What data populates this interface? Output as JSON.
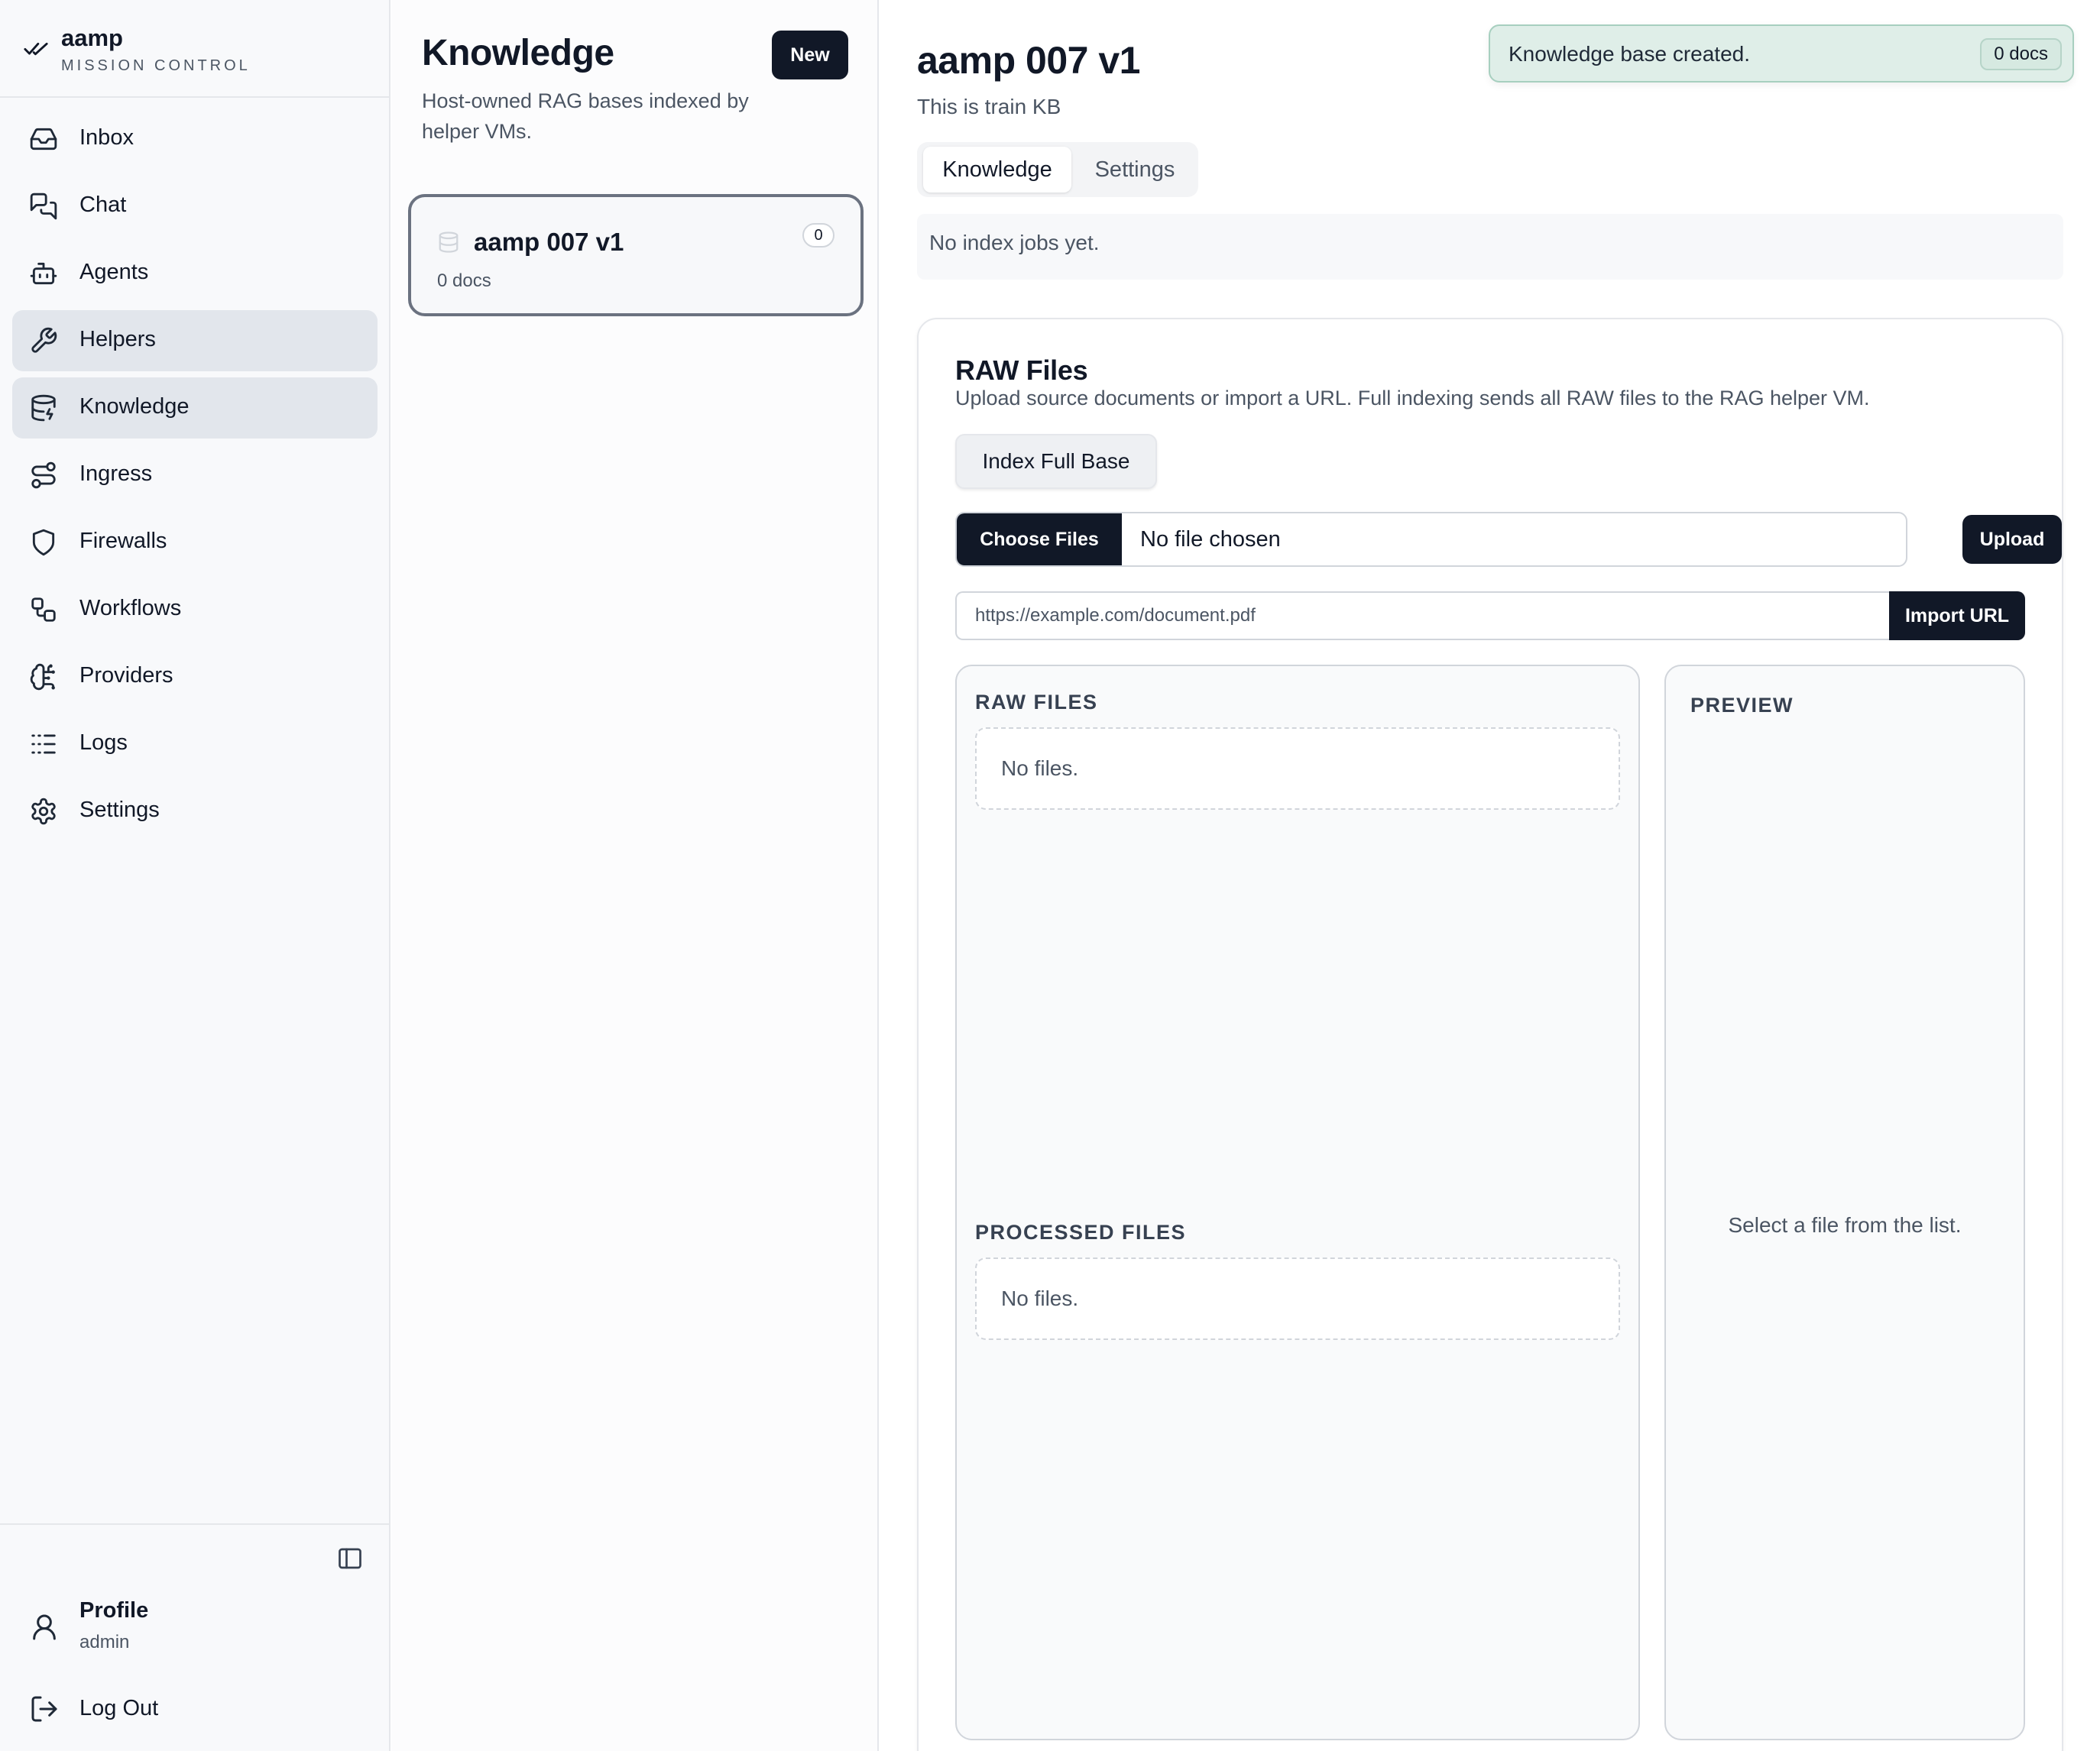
{
  "brand": {
    "name": "aamp",
    "tagline": "MISSION CONTROL"
  },
  "sidebar": {
    "items": [
      {
        "label": "Inbox",
        "icon": "inbox-icon",
        "active": false
      },
      {
        "label": "Chat",
        "icon": "chat-icon",
        "active": false
      },
      {
        "label": "Agents",
        "icon": "bot-icon",
        "active": false
      },
      {
        "label": "Helpers",
        "icon": "wrench-icon",
        "active": true
      },
      {
        "label": "Knowledge",
        "icon": "database-icon",
        "active": true
      },
      {
        "label": "Ingress",
        "icon": "route-icon",
        "active": false
      },
      {
        "label": "Firewalls",
        "icon": "shield-icon",
        "active": false
      },
      {
        "label": "Workflows",
        "icon": "workflow-icon",
        "active": false
      },
      {
        "label": "Providers",
        "icon": "brain-icon",
        "active": false
      },
      {
        "label": "Logs",
        "icon": "list-icon",
        "active": false
      },
      {
        "label": "Settings",
        "icon": "gear-icon",
        "active": false
      }
    ],
    "profile": {
      "label": "Profile",
      "user": "admin"
    },
    "logout_label": "Log Out"
  },
  "knowledge_list": {
    "title": "Knowledge",
    "description": "Host-owned RAG bases indexed by helper VMs.",
    "new_label": "New",
    "bases": [
      {
        "name": "aamp 007 v1",
        "docs": "0 docs",
        "count": "0"
      }
    ]
  },
  "detail": {
    "title": "aamp 007 v1",
    "subtitle": "This is train KB",
    "tabs": [
      "Knowledge",
      "Settings"
    ],
    "active_tab": "Knowledge",
    "jobs_empty": "No index jobs yet.",
    "toast": {
      "message": "Knowledge base created.",
      "badge": "0 docs"
    },
    "raw": {
      "heading": "RAW Files",
      "description": "Upload source documents or import a URL. Full indexing sends all RAW files to the RAG helper VM.",
      "index_label": "Index Full Base",
      "choose_label": "Choose Files",
      "no_file": "No file chosen",
      "upload_label": "Upload",
      "url_placeholder": "https://example.com/document.pdf",
      "import_label": "Import URL",
      "raw_files_label": "RAW FILES",
      "raw_files_empty": "No files.",
      "processed_label": "PROCESSED FILES",
      "processed_empty": "No files.",
      "preview_label": "PREVIEW",
      "preview_hint": "Select a file from the list."
    }
  },
  "colors": {
    "accent_dark": "#111827",
    "toast_bg": "#dfeee8",
    "active_nav_bg": "#e2e6ec"
  }
}
